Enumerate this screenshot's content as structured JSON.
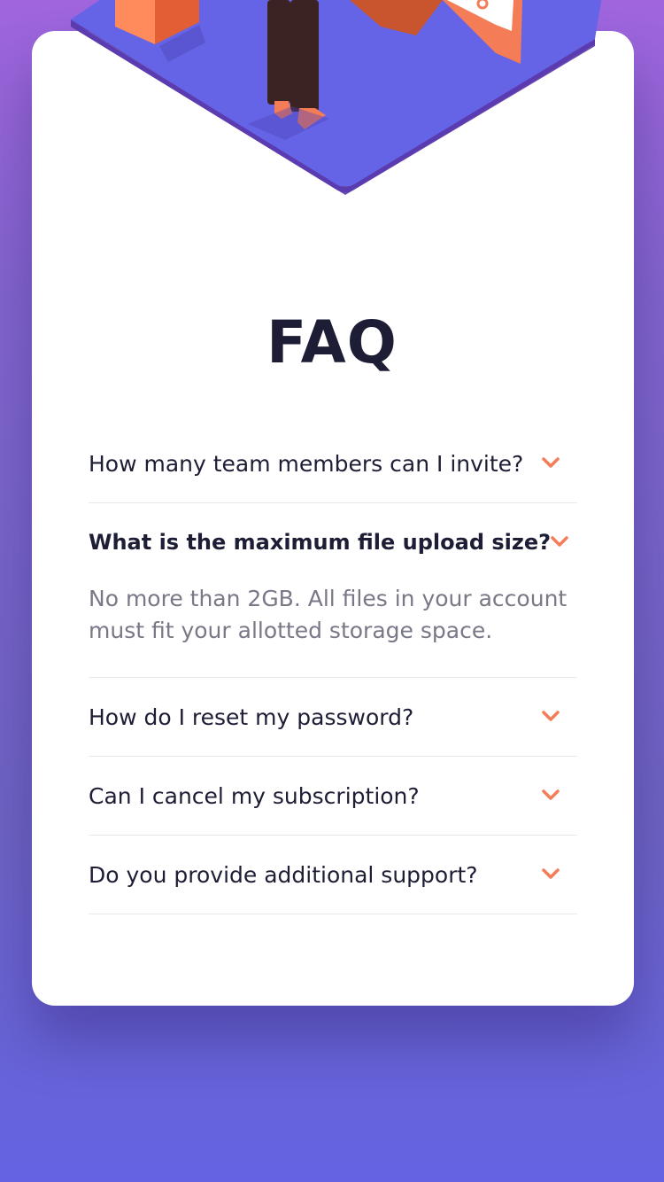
{
  "page": {
    "title": "FAQ"
  },
  "colors": {
    "accent": "#f47c57",
    "title": "#1d1e35",
    "answer": "#787887",
    "platform": "#6563e6",
    "background_top": "#a065dd",
    "background_bottom": "#6563e3"
  },
  "faq": {
    "items": [
      {
        "question": "How many team members can I invite?",
        "expanded": false
      },
      {
        "question": "What is the maximum file upload size?",
        "expanded": true,
        "answer": "No more than 2GB. All files in your account must fit your allotted storage space."
      },
      {
        "question": "How do I reset my password?",
        "expanded": false
      },
      {
        "question": "Can I cancel my subscription?",
        "expanded": false
      },
      {
        "question": "Do you provide additional support?",
        "expanded": false
      }
    ],
    "icon": "chevron-down-icon"
  }
}
